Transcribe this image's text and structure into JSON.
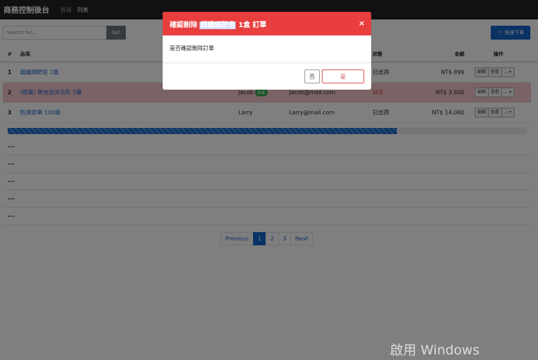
{
  "navbar": {
    "brand": "商務控制後台",
    "links": [
      "首頁",
      "列表"
    ],
    "active_index": 1
  },
  "search": {
    "placeholder": "Search for...",
    "button": "Go!"
  },
  "quick_order": {
    "icon": "cart-icon",
    "label": "快速下單"
  },
  "table": {
    "headers": {
      "num": "#",
      "item": "品項",
      "status": "狀態",
      "amount": "金額",
      "ops": "操作"
    },
    "rows": [
      {
        "num": "1",
        "item": "超纖細肥皂 1盒",
        "customer": "",
        "email": "",
        "badge": "",
        "status": "已出貨",
        "amount": "NT$ 899",
        "danger": false
      },
      {
        "num": "2",
        "item": "(限量) 無泡泡沐浴乳 5罐",
        "customer": "Jacob",
        "email": "Jacob@mail.com",
        "badge": "常客",
        "status": "缺貨",
        "amount": "NT$ 3,600",
        "danger": true
      },
      {
        "num": "3",
        "item": "防滑提單 100個",
        "customer": "Larry",
        "email": "Larry@mail.com",
        "badge": "",
        "status": "已出貨",
        "amount": "NT$ 14,060",
        "danger": false
      }
    ],
    "ops": {
      "edit": "編輯",
      "view": "查看",
      "more": "... ▾"
    }
  },
  "progress": {
    "value": 0.75,
    "color": "#1464c8"
  },
  "ellipsis_rows": [
    "...",
    "...",
    "...",
    "...",
    "..."
  ],
  "pagination": {
    "prev": "Previous",
    "pages": [
      "1",
      "2",
      "3"
    ],
    "next": "Next",
    "active": "1"
  },
  "modal": {
    "title_prefix": "確認刪除 ",
    "title_highlight": "超纖細肥皂",
    "title_suffix": " 1盒 訂單",
    "close": "×",
    "body": "是否確認刪除訂單",
    "no": "否",
    "yes": "是",
    "header_color": "#e83e3e"
  },
  "watermark": "啟用 Windows"
}
